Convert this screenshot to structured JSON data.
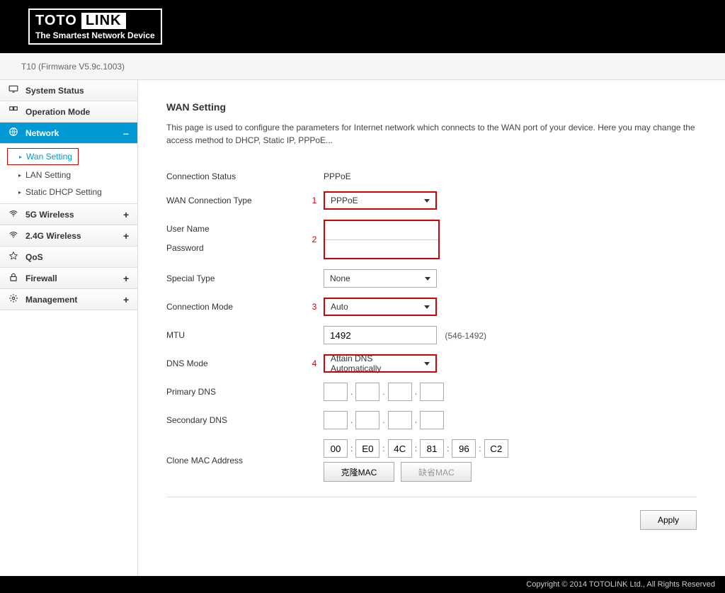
{
  "brand": {
    "name": "TOTO",
    "name2": "LINK",
    "tagline": "The Smartest Network Device"
  },
  "firmware": "T10 (Firmware V5.9c.1003)",
  "sidebar": {
    "items": [
      {
        "label": "System Status"
      },
      {
        "label": "Operation Mode"
      },
      {
        "label": "Network",
        "toggle": "–"
      },
      {
        "label": "5G Wireless",
        "toggle": "+"
      },
      {
        "label": "2.4G Wireless",
        "toggle": "+"
      },
      {
        "label": "QoS"
      },
      {
        "label": "Firewall",
        "toggle": "+"
      },
      {
        "label": "Management",
        "toggle": "+"
      }
    ],
    "network_sub": [
      {
        "label": "Wan Setting"
      },
      {
        "label": "LAN Setting"
      },
      {
        "label": "Static DHCP Setting"
      }
    ]
  },
  "page": {
    "title": "WAN Setting",
    "desc": "This page is used to configure the parameters for Internet network which connects to the WAN port of your device. Here you may change the access method to DHCP, Static IP, PPPoE..."
  },
  "labels": {
    "conn_status": "Connection Status",
    "wan_type": "WAN Connection Type",
    "username": "User Name",
    "password": "Password",
    "special": "Special Type",
    "conn_mode": "Connection Mode",
    "mtu": "MTU",
    "dns_mode": "DNS Mode",
    "pri_dns": "Primary DNS",
    "sec_dns": "Secondary DNS",
    "clone_mac": "Clone MAC Address"
  },
  "values": {
    "conn_status": "PPPoE",
    "wan_type": "PPPoE",
    "username": "",
    "password": "",
    "special": "None",
    "conn_mode": "Auto",
    "mtu": "1492",
    "mtu_hint": "(546-1492)",
    "dns_mode": "Attain DNS Automatically",
    "mac": [
      "00",
      "E0",
      "4C",
      "81",
      "96",
      "C2"
    ]
  },
  "nums": {
    "n1": "1",
    "n2": "2",
    "n3": "3",
    "n4": "4"
  },
  "buttons": {
    "clone": "克隆MAC",
    "default": "缺省MAC",
    "apply": "Apply"
  },
  "footer": "Copyright © 2014 TOTOLINK Ltd.,   All Rights Reserved"
}
